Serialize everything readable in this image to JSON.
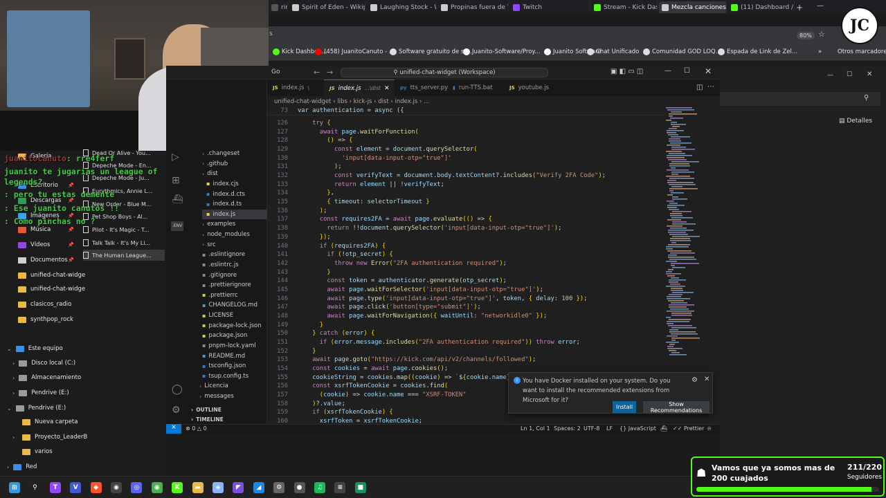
{
  "browser": {
    "tabs": [
      {
        "label": "ring",
        "color": "#555"
      },
      {
        "label": "Spirit of Eden - Wikip",
        "color": "#cccccc"
      },
      {
        "label": "Laughing Stock - Wik",
        "color": "#cccccc"
      },
      {
        "label": "Propinas fuera de Twi",
        "color": "#cccccc"
      },
      {
        "label": "Twitch",
        "color": "#9146ff"
      },
      {
        "label": "Stream - Kick Dashbo",
        "color": "#53fc18"
      },
      {
        "label": "Mezcla canciones",
        "color": "#cccccc"
      },
      {
        "label": "(11) Dashboard / Stre",
        "color": "#53fc18"
      }
    ],
    "zoom": "80%",
    "bookmarks": [
      {
        "label": "Kick Dashboa...",
        "color": "#53fc18"
      },
      {
        "label": "(458) JuanitoCanuto - ...",
        "color": "#ff0000"
      },
      {
        "label": "Software gratuito de st...",
        "color": "#dddddd"
      },
      {
        "label": "Juanito-Software/Proy...",
        "color": "#ffffff"
      },
      {
        "label": "Juanito Software",
        "color": "#ffffff"
      },
      {
        "label": "Chat Unificado",
        "color": "#dddddd"
      },
      {
        "label": "Comunidad GOD LOQ...",
        "color": "#dddddd"
      },
      {
        "label": "Espada de Link de Zel...",
        "color": "#dddddd"
      }
    ],
    "other_bookmarks": "Otros marcadores",
    "more_label": "»"
  },
  "explorer": {
    "quick_access": [
      {
        "label": "Galería"
      },
      {
        "label": "Escritorio"
      },
      {
        "label": "Descargas"
      },
      {
        "label": "Imágenes"
      },
      {
        "label": "Música"
      },
      {
        "label": "Vídeos"
      },
      {
        "label": "Documentos"
      },
      {
        "label": "unified-chat-widge"
      },
      {
        "label": "unified-chat-widge"
      },
      {
        "label": "clasicos_radio"
      },
      {
        "label": "synthpop_rock"
      }
    ],
    "this_pc": "Este equipo",
    "drives": [
      {
        "label": "Disco local (C:)"
      },
      {
        "label": "Almacenamiento"
      },
      {
        "label": "Pendrive (E:)"
      }
    ],
    "pendrive": "Pendrive (E:)",
    "pendrive_children": [
      {
        "label": "Nueva carpeta"
      },
      {
        "label": "Proyecto_LeaderB"
      },
      {
        "label": "varios"
      }
    ],
    "network": "Red",
    "songs": [
      "Dead Or Alive - You...",
      "Depeche Mode - En...",
      "Depeche Mode - Ju...",
      "Eurythmics, Annie L...",
      "New Order - Blue M...",
      "Pet Shop Boys - Al...",
      "Pilot - It's Magic - T...",
      "Talk Talk - It's My Li...",
      "The Human League..."
    ]
  },
  "chat": [
    {
      "user": "juanitocanuto",
      "text": ": rre4ferf"
    },
    {
      "user": "",
      "text": "juanito te jugarias un league of"
    },
    {
      "user": "",
      "text": "legends?"
    },
    {
      "user": "",
      "text": ": pero tu estas demente"
    },
    {
      "user": "",
      "text": ": Ese juanito canutos !!"
    },
    {
      "user": "",
      "text": ": Como pinchas no ?"
    }
  ],
  "vscode": {
    "menu": "Go",
    "search": "unified-chat-widget (Workspace)",
    "tabs": [
      {
        "label": "index.js",
        "extra": "\\",
        "active": false
      },
      {
        "label": "index.js",
        "extra": "...\\dist",
        "active": true
      },
      {
        "label": "tts_server.py",
        "extra": "",
        "active": false
      },
      {
        "label": "run-TTS.bat",
        "extra": "",
        "active": false
      },
      {
        "label": "youtube.js",
        "extra": "",
        "active": false
      }
    ],
    "breadcrumb": "unified-chat-widget  ›  libs  ›  kick-js  ›  dist  ›  index.js  ›  ...",
    "sticky": {
      "line": "73",
      "code": "var authentication = async ({"
    },
    "tree": [
      {
        "label": ".changeset",
        "kind": "folder",
        "indent": 0
      },
      {
        "label": ".github",
        "kind": "folder",
        "indent": 0
      },
      {
        "label": "dist",
        "kind": "folder",
        "indent": 0
      },
      {
        "label": "index.cjs",
        "kind": "js",
        "indent": 1
      },
      {
        "label": "index.d.cts",
        "kind": "ts",
        "indent": 1
      },
      {
        "label": "index.d.ts",
        "kind": "ts",
        "indent": 1
      },
      {
        "label": "index.js",
        "kind": "js",
        "indent": 1
      },
      {
        "label": "examples",
        "kind": "folder",
        "indent": 0
      },
      {
        "label": "node_modules",
        "kind": "folder",
        "indent": 0
      },
      {
        "label": "src",
        "kind": "folder",
        "indent": 0
      },
      {
        "label": ".eslintignore",
        "kind": "cfg",
        "indent": 0
      },
      {
        "label": ".eslintrc.js",
        "kind": "cfg",
        "indent": 0
      },
      {
        "label": ".gitignore",
        "kind": "cfg",
        "indent": 0
      },
      {
        "label": ".prettierignore",
        "kind": "cfg",
        "indent": 0
      },
      {
        "label": ".prettierrc",
        "kind": "json",
        "indent": 0
      },
      {
        "label": "CHANGELOG.md",
        "kind": "md",
        "indent": 0
      },
      {
        "label": "LICENSE",
        "kind": "lic",
        "indent": 0
      },
      {
        "label": "package-lock.json",
        "kind": "json",
        "indent": 0
      },
      {
        "label": "package.json",
        "kind": "json",
        "indent": 0
      },
      {
        "label": "pnpm-lock.yaml",
        "kind": "cfg",
        "indent": 0
      },
      {
        "label": "README.md",
        "kind": "md",
        "indent": 0
      },
      {
        "label": "tsconfig.json",
        "kind": "ts",
        "indent": 0
      },
      {
        "label": "tsup.config.ts",
        "kind": "ts",
        "indent": 0
      },
      {
        "label": "Licencia",
        "kind": "folder",
        "indent": -1
      },
      {
        "label": "messages",
        "kind": "folder",
        "indent": -1
      }
    ],
    "outline": "OUTLINE",
    "timeline": "TIMELINE",
    "code": [
      {
        "n": "126",
        "t": "    try {"
      },
      {
        "n": "127",
        "t": "      await page.waitForFunction("
      },
      {
        "n": "128",
        "t": "        () => {"
      },
      {
        "n": "129",
        "t": "          const element = document.querySelector("
      },
      {
        "n": "130",
        "t": "            'input[data-input-otp=\"true\"]'"
      },
      {
        "n": "131",
        "t": "          );"
      },
      {
        "n": "132",
        "t": "          const verifyText = document.body.textContent?.includes(\"Verify 2FA Code\");"
      },
      {
        "n": "133",
        "t": "          return element || !verifyText;"
      },
      {
        "n": "134",
        "t": "        },"
      },
      {
        "n": "135",
        "t": "        { timeout: selectorTimeout }"
      },
      {
        "n": "136",
        "t": "      );"
      },
      {
        "n": "137",
        "t": "      const requires2FA = await page.evaluate(() => {"
      },
      {
        "n": "138",
        "t": "        return !!document.querySelector('input[data-input-otp=\"true\"]');"
      },
      {
        "n": "139",
        "t": "      });"
      },
      {
        "n": "140",
        "t": "      if (requires2FA) {"
      },
      {
        "n": "141",
        "t": "        if (!otp_secret) {"
      },
      {
        "n": "142",
        "t": "          throw new Error(\"2FA authentication required\");"
      },
      {
        "n": "143",
        "t": "        }"
      },
      {
        "n": "144",
        "t": "        const token = authenticator.generate(otp_secret);"
      },
      {
        "n": "145",
        "t": "        await page.waitForSelector('input[data-input-otp=\"true\"]');"
      },
      {
        "n": "146",
        "t": "        await page.type('input[data-input-otp=\"true\"]', token, { delay: 100 });"
      },
      {
        "n": "147",
        "t": "        await page.click('button[type=\"submit\"]');"
      },
      {
        "n": "148",
        "t": "        await page.waitForNavigation({ waitUntil: \"networkidle0\" });"
      },
      {
        "n": "149",
        "t": "      }"
      },
      {
        "n": "150",
        "t": "    } catch (error) {"
      },
      {
        "n": "151",
        "t": "      if (error.message.includes(\"2FA authentication required\")) throw error;"
      },
      {
        "n": "152",
        "t": "    }"
      },
      {
        "n": "153",
        "t": "    await page.goto(\"https://kick.com/api/v2/channels/followed\");"
      },
      {
        "n": "154",
        "t": "    const cookies = await page.cookies();"
      },
      {
        "n": "155",
        "t": "    cookieString = cookies.map((cookie) => `${cookie.name}="
      },
      {
        "n": "156",
        "t": "    const xsrfTokenCookie = cookies.find("
      },
      {
        "n": "157",
        "t": "      (cookie) => cookie.name === \"XSRF-TOKEN\""
      },
      {
        "n": "158",
        "t": "    )?.value;"
      },
      {
        "n": "159",
        "t": "    if (xsrfTokenCookie) {"
      },
      {
        "n": "160",
        "t": "      xsrfToken = xsrfTokenCookie;"
      }
    ],
    "notification": {
      "message": "You have Docker installed on your system. Do you want to install the recommended extensions from Microsoft for it?",
      "install": "Install",
      "show": "Show Recommendations"
    },
    "status": {
      "errors": "0",
      "warnings": "0",
      "position": "Ln 1, Col 1",
      "spaces": "Spaces: 2",
      "encoding": "UTF-8",
      "eol": "LF",
      "language": "JavaScript",
      "formatter": "Prettier"
    }
  },
  "right_window": {
    "details": "Detalles"
  },
  "goal": {
    "text": "Vamos que ya somos mas de 200 cuajados",
    "count": "211/220",
    "label": "Seguidores",
    "progress": 0.959
  }
}
